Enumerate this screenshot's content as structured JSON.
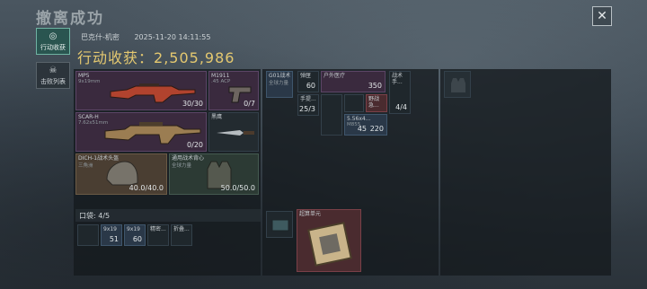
{
  "title": "撤离成功",
  "close_icon": "close-icon",
  "side_tabs": [
    {
      "label": "行动收获",
      "icon": "target-icon",
      "active": true
    },
    {
      "label": "击败列表",
      "icon": "skull-icon",
      "active": false
    }
  ],
  "meta": {
    "location": "巴克什-机密",
    "datetime": "2025-11-20 14:11:55"
  },
  "loot": {
    "label": "行动收获：",
    "value": "2,505,986"
  },
  "weapons": [
    {
      "name": "MP5",
      "caliber": "9x19mm",
      "ammo": "30/30"
    },
    {
      "name": "SCAR-H",
      "caliber": "7.62x51mm",
      "ammo": "0/20"
    },
    {
      "name": "M1911",
      "caliber": ".45 ACP",
      "ammo": "0/7"
    },
    {
      "name": "黑鹰",
      "caliber": "",
      "ammo": ""
    }
  ],
  "armor": [
    {
      "name": "DICH-1战术头盔",
      "sub": "三角洲",
      "durability": "40.0/40.0"
    },
    {
      "name": "通用战术背心",
      "sub": "全球力量",
      "durability": "50.0/50.0"
    }
  ],
  "backpack_items": [
    {
      "name": "G01战术",
      "sub": "全球力量",
      "count": ""
    },
    {
      "name": "弹匣",
      "sub": "",
      "count": "60"
    },
    {
      "name": "户外医疗",
      "sub": "",
      "count": "350"
    },
    {
      "name": "战术手...",
      "sub": "",
      "count": "4/4"
    },
    {
      "name": "手提...",
      "sub": "",
      "count": "25/3"
    },
    {
      "name": "野战急...",
      "sub": "",
      "count": ""
    },
    {
      "name": "5.56x4...",
      "sub": "M855",
      "count": "45"
    },
    {
      "name": "",
      "sub": "",
      "count": "220"
    }
  ],
  "pocket": {
    "label": "口袋: 4/5",
    "items": [
      {
        "name": "9x19",
        "sub": "",
        "count": "51"
      },
      {
        "name": "9x19",
        "sub": "",
        "count": "60"
      },
      {
        "name": "精密...",
        "sub": "",
        "count": ""
      },
      {
        "name": "折叠...",
        "sub": "",
        "count": ""
      }
    ]
  },
  "extra_items": [
    {
      "name": "",
      "sub": "",
      "count": ""
    },
    {
      "name": "超算单元",
      "sub": "",
      "count": ""
    }
  ]
}
